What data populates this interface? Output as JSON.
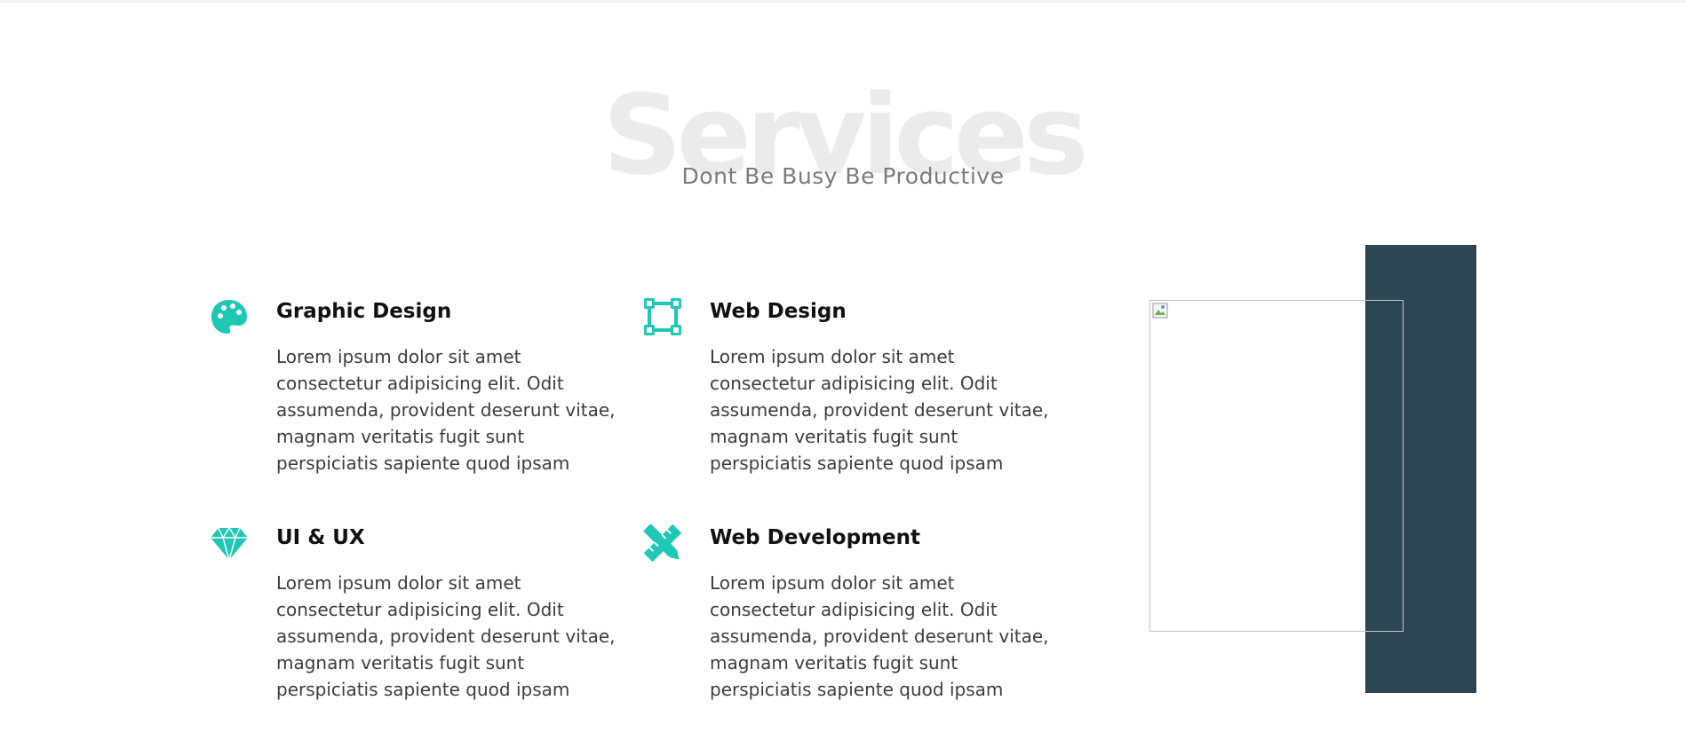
{
  "header": {
    "title": "Services",
    "subtitle": "Dont Be Busy Be Productive"
  },
  "services": [
    {
      "icon": "palette-icon",
      "title": "Graphic Design",
      "description": "Lorem ipsum dolor sit amet consectetur adipisicing elit. Odit assumenda, provident deserunt vitae, magnam veritatis fugit sunt perspiciatis sapiente quod ipsam"
    },
    {
      "icon": "vector-square-icon",
      "title": "Web Design",
      "description": "Lorem ipsum dolor sit amet consectetur adipisicing elit. Odit assumenda, provident deserunt vitae, magnam veritatis fugit sunt perspiciatis sapiente quod ipsam"
    },
    {
      "icon": "gem-icon",
      "title": "UI & UX",
      "description": "Lorem ipsum dolor sit amet consectetur adipisicing elit. Odit assumenda, provident deserunt vitae, magnam veritatis fugit sunt perspiciatis sapiente quod ipsam"
    },
    {
      "icon": "pencil-ruler-icon",
      "title": "Web Development",
      "description": "Lorem ipsum dolor sit amet consectetur adipisicing elit. Odit assumenda, provident deserunt vitae, magnam veritatis fugit sunt perspiciatis sapiente quod ipsam"
    }
  ],
  "colors": {
    "accent": "#1fc8b4",
    "dark_block": "#2c4654",
    "title_watermark": "#ebebeb",
    "subtitle": "#7a7a7a"
  },
  "image": {
    "state": "broken-image"
  }
}
